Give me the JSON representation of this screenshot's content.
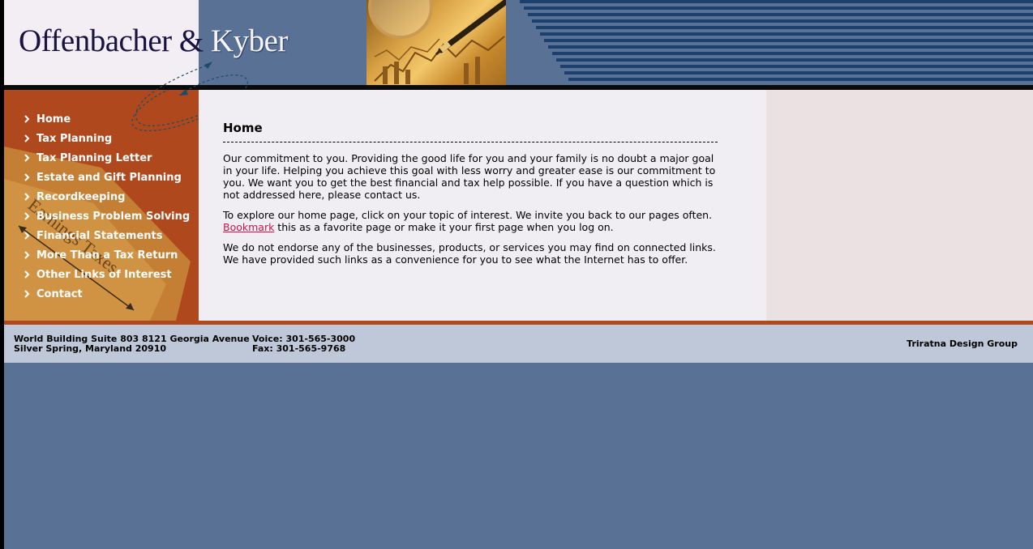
{
  "header": {
    "logo_part1": "Offenbacher",
    "logo_amp": "&",
    "logo_part2": "Kyber"
  },
  "sidebar": {
    "items": [
      {
        "label": "Home"
      },
      {
        "label": "Tax Planning"
      },
      {
        "label": "Tax Planning Letter"
      },
      {
        "label": "Estate and Gift Planning"
      },
      {
        "label": "Recordkeeping"
      },
      {
        "label": "Business Problem Solving"
      },
      {
        "label": "Financial Statements"
      },
      {
        "label": "More Than a Tax Return"
      },
      {
        "label": "Other Links of Interest"
      },
      {
        "label": "Contact"
      }
    ],
    "background_text": "Earnings Taxes"
  },
  "main": {
    "title": "Home",
    "paragraph1": "Our commitment to you. Providing the good life for you and your family is no doubt a major goal in your life. Helping you achieve this goal with less worry and greater ease is our commitment to you. We want you to get the best financial and tax help possible. If you have a question which is not addressed here, please contact us.",
    "paragraph2_prefix": "To explore our home page, click on your topic of interest. We invite you back to our pages often.",
    "bookmark_link": "Bookmark",
    "paragraph2_suffix": " this as a favorite page or make it your first page when you log on.",
    "paragraph3": "We do not endorse any of the businesses, products, or services you may find on connected links. We have provided such links as a convenience for you to see what the Internet has to offer."
  },
  "footer": {
    "address_line1": "World Building Suite 803 8121 Georgia Avenue",
    "address_line2": "Silver Spring, Maryland 20910",
    "voice": "Voice: 301-565-3000",
    "fax": "Fax: 301-565-9768",
    "credit": "Triratna Design Group"
  },
  "colors": {
    "sidebar_bg": "#b0481d",
    "page_blue": "#587195",
    "content_bg": "#f1eef3",
    "link_color": "#c8154d",
    "footer_bg": "#bec8d8"
  },
  "icons": [
    "chevron-right-icon",
    "magnifier-pen-photo",
    "dotted-arrow-swoosh"
  ]
}
